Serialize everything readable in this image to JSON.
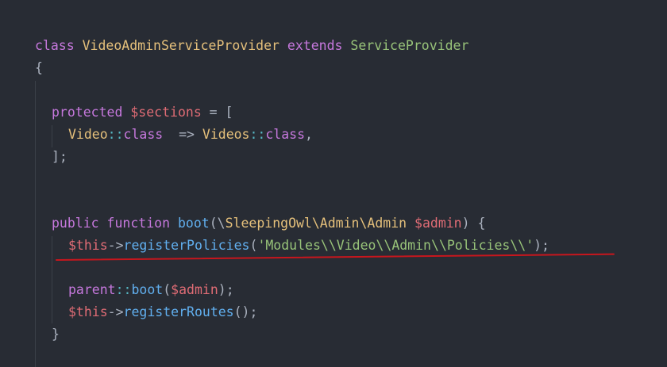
{
  "code": {
    "line1": {
      "kw_class": "class",
      "class_name": "VideoAdminServiceProvider",
      "kw_extends": "extends",
      "parent_name": "ServiceProvider"
    },
    "line2": {
      "brace": "{"
    },
    "line4": {
      "kw_protected": "protected",
      "var": "$sections",
      "assign": " = ["
    },
    "line5": {
      "cls1": "Video",
      "op1": "::",
      "kw1": "class",
      "arrow": "  => ",
      "cls2": "Videos",
      "op2": "::",
      "kw2": "class",
      "comma": ","
    },
    "line6": {
      "close": "];"
    },
    "line9": {
      "kw_public": "public",
      "kw_function": "function",
      "fn": "boot",
      "paren_open": "(\\",
      "ns": "SleepingOwl\\Admin\\Admin",
      "param": "$admin",
      "tail": ") {"
    },
    "line10": {
      "this": "$this",
      "arrow": "->",
      "method": "registerPolicies",
      "open": "(",
      "str": "'Modules\\\\Video\\\\Admin\\\\Policies\\\\'",
      "close": ");"
    },
    "line12": {
      "kw_parent": "parent",
      "op": "::",
      "method": "boot",
      "open": "(",
      "arg": "$admin",
      "close": ");"
    },
    "line13": {
      "this": "$this",
      "arrow": "->",
      "method": "registerRoutes",
      "call": "();"
    },
    "line14": {
      "brace": "}"
    }
  },
  "colors": {
    "background": "#282c34",
    "keyword": "#c678dd",
    "class_name": "#e5c07b",
    "inherited_class": "#98c379",
    "variable": "#e06c75",
    "function": "#61afef",
    "operator": "#56b6c2",
    "annotation_underline": "#c8161d"
  }
}
